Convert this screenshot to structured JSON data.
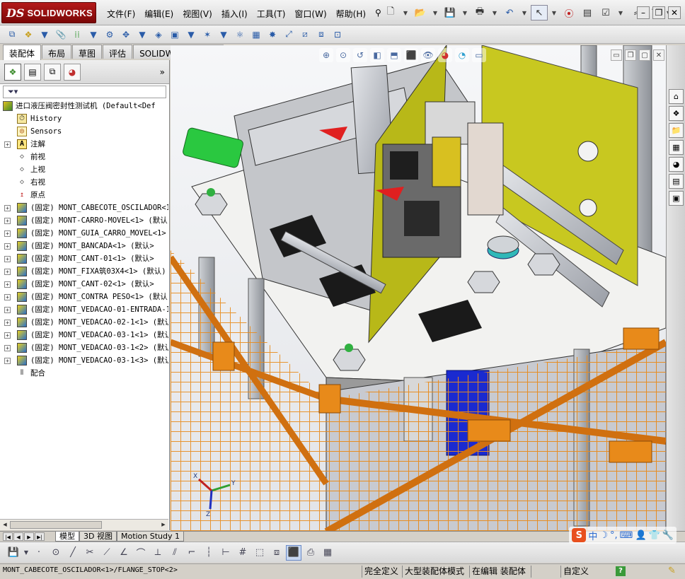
{
  "app": {
    "brand_mark": "DS",
    "brand_name": "SOLIDWORKS"
  },
  "menu": {
    "items": [
      "文件(F)",
      "编辑(E)",
      "视图(V)",
      "插入(I)",
      "工具(T)",
      "窗口(W)",
      "帮助(H)"
    ]
  },
  "command_tabs": [
    "装配体",
    "布局",
    "草图",
    "评估",
    "SOLIDWORKS 插件"
  ],
  "tree": {
    "root": "进口液压阀密封性测试机  (Default<Def",
    "items": [
      {
        "label": "History",
        "icon": "history-icon",
        "exp": ""
      },
      {
        "label": "Sensors",
        "icon": "sensors-icon",
        "exp": ""
      },
      {
        "label": "注解",
        "icon": "annotations-icon",
        "exp": "+"
      },
      {
        "label": "前视",
        "icon": "plane-icon",
        "exp": ""
      },
      {
        "label": "上视",
        "icon": "plane-icon",
        "exp": ""
      },
      {
        "label": "右视",
        "icon": "plane-icon",
        "exp": ""
      },
      {
        "label": "原点",
        "icon": "origin-icon",
        "exp": ""
      },
      {
        "label": "(固定) MONT_CABECOTE_OSCILADOR<1",
        "icon": "subassembly-icon",
        "exp": "+"
      },
      {
        "label": "(固定) MONT-CARRO-MOVEL<1> (默认",
        "icon": "subassembly-icon",
        "exp": "+"
      },
      {
        "label": "(固定) MONT_GUIA_CARRO_MOVEL<1>",
        "icon": "subassembly-icon",
        "exp": "+"
      },
      {
        "label": "(固定) MONT_BANCADA<1> (默认>",
        "icon": "subassembly-icon",
        "exp": "+"
      },
      {
        "label": "(固定) MONT_CANT-01<1> (默认>",
        "icon": "subassembly-icon",
        "exp": "+"
      },
      {
        "label": "(固定) MONT_FIXA筑03X4<1> (默认)",
        "icon": "subassembly-icon",
        "exp": "+"
      },
      {
        "label": "(固定) MONT_CANT-02<1> (默认>",
        "icon": "subassembly-icon",
        "exp": "+"
      },
      {
        "label": "(固定) MONT_CONTRA PESO<1> (默认",
        "icon": "subassembly-icon",
        "exp": "+"
      },
      {
        "label": "(固定) MONT_VEDACAO-01-ENTRADA-1",
        "icon": "subassembly-icon",
        "exp": "+"
      },
      {
        "label": "(固定) MONT_VEDACAO-02-1<1> (默认",
        "icon": "subassembly-icon",
        "exp": "+"
      },
      {
        "label": "(固定) MONT_VEDACAO-03-1<1> (默认",
        "icon": "subassembly-icon",
        "exp": "+"
      },
      {
        "label": "(固定) MONT_VEDACAO-03-1<2> (默认",
        "icon": "subassembly-icon",
        "exp": "+"
      },
      {
        "label": "(固定) MONT_VEDACAO-03-1<3> (默认",
        "icon": "subassembly-icon",
        "exp": "+"
      },
      {
        "label": "配合",
        "icon": "mates-icon",
        "exp": ""
      }
    ]
  },
  "bottom_tabs": [
    "模型",
    "3D 视图",
    "Motion Study 1"
  ],
  "status": {
    "message": "MONT_CABECOTE_OSCILADOR<1>/FLANGE_STOP<2>",
    "state": "完全定义",
    "mode": "大型装配体模式",
    "editing": "在编辑 装配体",
    "units": "自定义",
    "help": "?"
  },
  "triad": {
    "x": "Y",
    "z": "Z",
    "xx": "X"
  },
  "ime": {
    "logo": "S",
    "lang": "中"
  },
  "colors": {
    "brand_red": "#9a0f0f",
    "mesh_orange": "#e88a1a",
    "panel_yellow": "#c8c820",
    "motor_blue": "#1a2ad0",
    "frame_gray": "#b9bcc2"
  }
}
